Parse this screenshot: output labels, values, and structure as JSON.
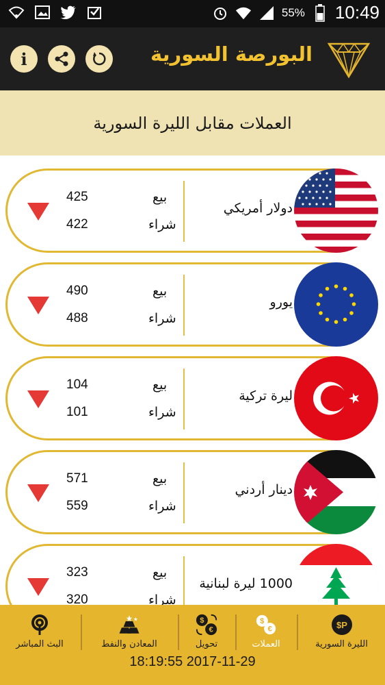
{
  "status_bar": {
    "battery_percent": "55%",
    "time": "10:49",
    "icons": [
      "wifi-signal-icon",
      "gallery-icon",
      "twitter-icon",
      "download-icon",
      "alarm-icon",
      "wifi-icon",
      "cell-signal-icon",
      "battery-icon"
    ]
  },
  "app_bar": {
    "title": "البورصة السورية",
    "actions": [
      "info-icon",
      "share-icon",
      "refresh-icon"
    ]
  },
  "section": {
    "title": "العملات مقابل الليرة السورية"
  },
  "labels": {
    "sell": "بيع",
    "buy": "شراء"
  },
  "currencies": [
    {
      "name": "دولار أمريكي",
      "sell": "425",
      "buy": "422",
      "trend": "down",
      "flag": "us-flag"
    },
    {
      "name": "يورو",
      "sell": "490",
      "buy": "488",
      "trend": "down",
      "flag": "eu-flag"
    },
    {
      "name": "ليرة تركية",
      "sell": "104",
      "buy": "101",
      "trend": "down",
      "flag": "turkey-flag"
    },
    {
      "name": "دينار أردني",
      "sell": "571",
      "buy": "559",
      "trend": "down",
      "flag": "jordan-flag"
    },
    {
      "name": "1000 ليرة لبنانية",
      "sell": "323",
      "buy": "320",
      "trend": "down",
      "flag": "lebanon-flag"
    }
  ],
  "bottom_nav": {
    "items": [
      {
        "label": "البث المباشر",
        "icon": "live-broadcast-icon",
        "active": false
      },
      {
        "label": "المعادن والنفط",
        "icon": "gold-bars-icon",
        "active": false
      },
      {
        "label": "تحويل",
        "icon": "convert-icon",
        "active": false
      },
      {
        "label": "العملات",
        "icon": "currencies-icon",
        "active": true
      },
      {
        "label": "الليرة السورية",
        "icon": "syrian-pound-icon",
        "active": false
      }
    ],
    "timestamp": "18:19:55 2017-11-29"
  },
  "colors": {
    "gold": "#e6b52e",
    "header_bg": "#1f1f1f",
    "section_bg": "#efe2b3",
    "trend_down": "#e53935"
  }
}
